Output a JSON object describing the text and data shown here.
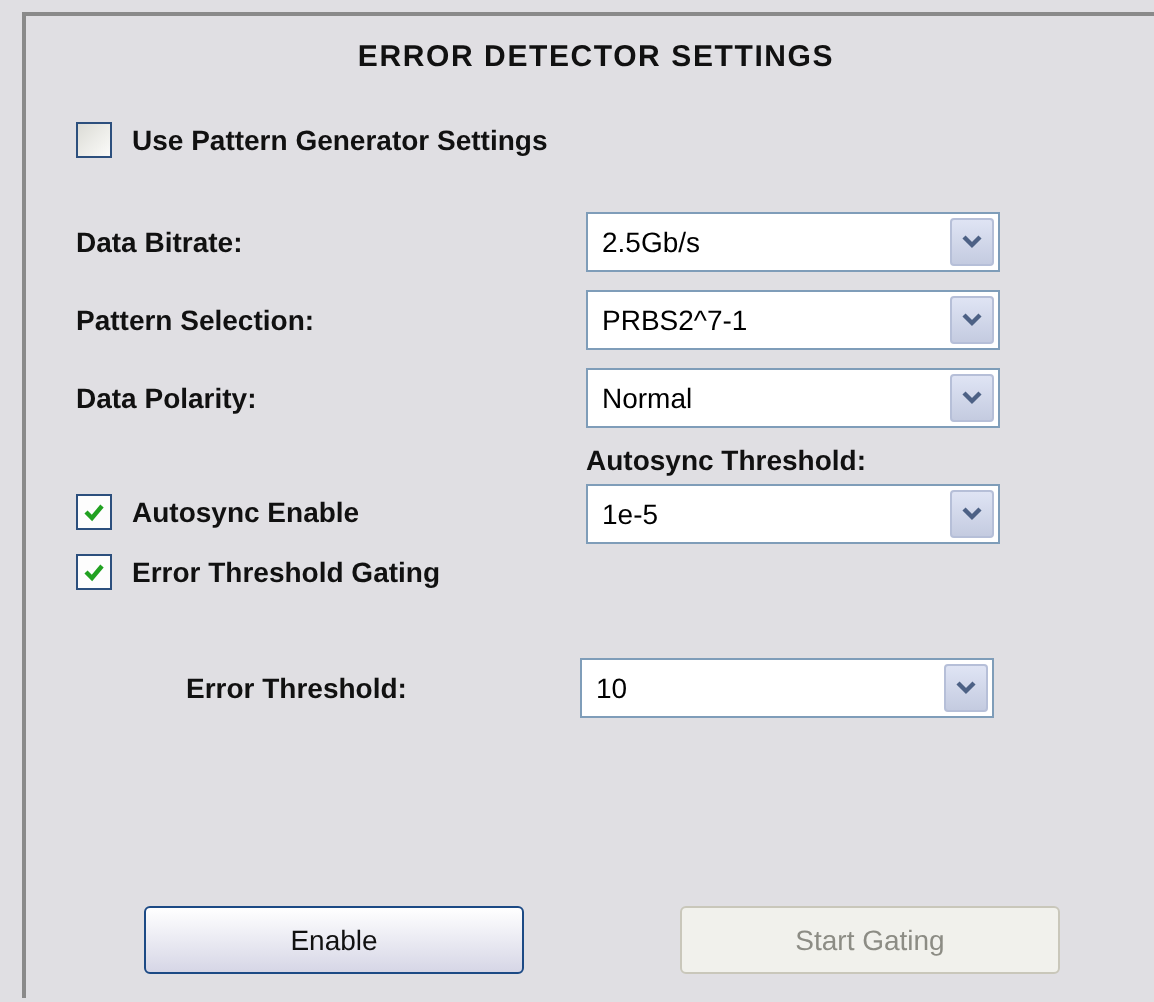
{
  "title": "ERROR DETECTOR SETTINGS",
  "rows": [
    {
      "kind": "checkbox",
      "label": "Use Pattern Generator Settings",
      "checked": false
    },
    {
      "kind": "select",
      "label": "Data Bitrate:",
      "value": "2.5Gb/s"
    },
    {
      "kind": "select",
      "label": "Pattern Selection:",
      "value": "PRBS2^7-1"
    },
    {
      "kind": "select",
      "label": "Data Polarity:",
      "value": "Normal"
    },
    {
      "kind": "checkbox_select",
      "label": "Autosync Enable",
      "checked": true,
      "select_label": "Autosync Threshold:",
      "value": "1e-5"
    },
    {
      "kind": "checkbox",
      "label": "Error Threshold Gating",
      "checked": true
    },
    {
      "kind": "indented_select",
      "label": "Error Threshold:",
      "value": "10"
    }
  ],
  "buttons": [
    {
      "label": "Enable",
      "disabled": false
    },
    {
      "label": "Start Gating",
      "disabled": true
    }
  ]
}
